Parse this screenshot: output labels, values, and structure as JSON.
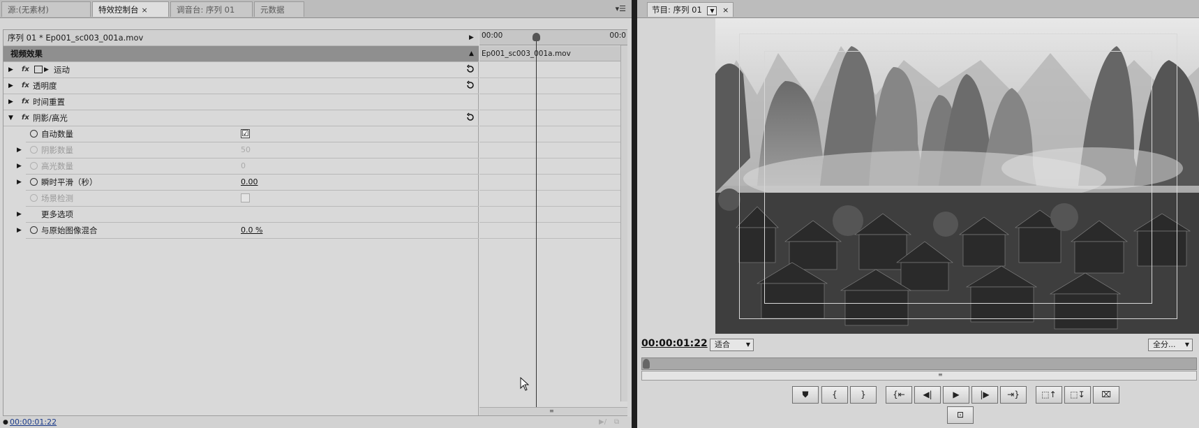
{
  "left_tabs": [
    {
      "label": "源:(无素材)",
      "active": false
    },
    {
      "label": "特效控制台",
      "active": true,
      "close": "×"
    },
    {
      "label": "调音台: 序列 01",
      "active": false
    },
    {
      "label": "元数据",
      "active": false
    }
  ],
  "panel_menu": "▾☰",
  "effect_controls": {
    "header_clip": "序列 01 * Ep001_sc003_001a.mov",
    "section_title": "视频效果",
    "fx_label": "fx",
    "effects": [
      {
        "name": "运动",
        "enabled": true
      },
      {
        "name": "透明度",
        "enabled": true
      },
      {
        "name": "时间重置",
        "enabled": false
      },
      {
        "name": "阴影/高光",
        "enabled": true,
        "expanded": true
      }
    ],
    "params": [
      {
        "name": "自动数量",
        "value": "☑"
      },
      {
        "name": "阴影数量",
        "value": "50"
      },
      {
        "name": "高光数量",
        "value": "0"
      },
      {
        "name": "瞬时平滑（秒）",
        "value": "0.00"
      },
      {
        "name": "场景检测",
        "value": ""
      },
      {
        "name": "更多选项",
        "value": ""
      },
      {
        "name": "与原始图像混合",
        "value": "0.0 %"
      }
    ]
  },
  "timeline": {
    "start": "00:00",
    "end": "00:0",
    "clip": "Ep001_sc003_001a.mov",
    "scroll_mark": "≡"
  },
  "footer": {
    "timecode": "00:00:01:22",
    "icons": [
      "▶/",
      "⧉"
    ]
  },
  "program": {
    "tab_label": "节目: 序列 01",
    "tab_dropdown": "▼",
    "tab_close": "×",
    "timecode": "00:00:01:22",
    "fit_value": "适合",
    "full_value": "全分...",
    "dropdown_arrow": "▼",
    "zoom_mark": "≡",
    "transport": [
      {
        "name": "add-marker",
        "glyph": "⛊"
      },
      {
        "name": "mark-in",
        "glyph": "{"
      },
      {
        "name": "mark-out",
        "glyph": "}"
      },
      {
        "name": "go-to-in",
        "glyph": "{⇤"
      },
      {
        "name": "step-back",
        "glyph": "◀|"
      },
      {
        "name": "play",
        "glyph": "▶"
      },
      {
        "name": "step-forward",
        "glyph": "|▶"
      },
      {
        "name": "go-to-out",
        "glyph": "⇥}"
      },
      {
        "name": "lift",
        "glyph": "⬚↑"
      },
      {
        "name": "extract",
        "glyph": "⬚↧"
      },
      {
        "name": "export-frame",
        "glyph": "⌧"
      }
    ],
    "safe_margins_glyph": "⊡"
  }
}
